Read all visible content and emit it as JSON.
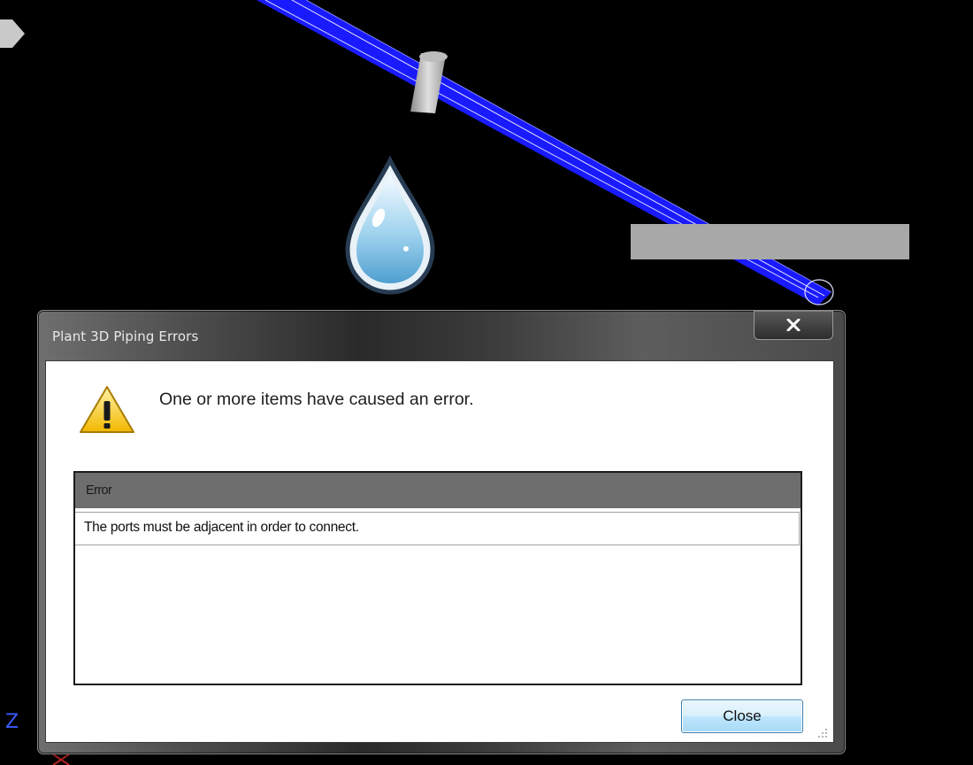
{
  "dialog": {
    "title": "Plant 3D Piping Errors",
    "close_icon": "close-icon",
    "warning_icon": "warning-icon",
    "message": "One or more items have caused an error.",
    "error_list": {
      "header": "Error",
      "rows": [
        "The ports must be adjacent in order to connect."
      ]
    },
    "close_button_label": "Close"
  },
  "viewport": {
    "axis_label": "Z",
    "water_drop_icon": "water-drop-icon",
    "pipe_color": "#1a1aff",
    "background_color": "#000000"
  }
}
